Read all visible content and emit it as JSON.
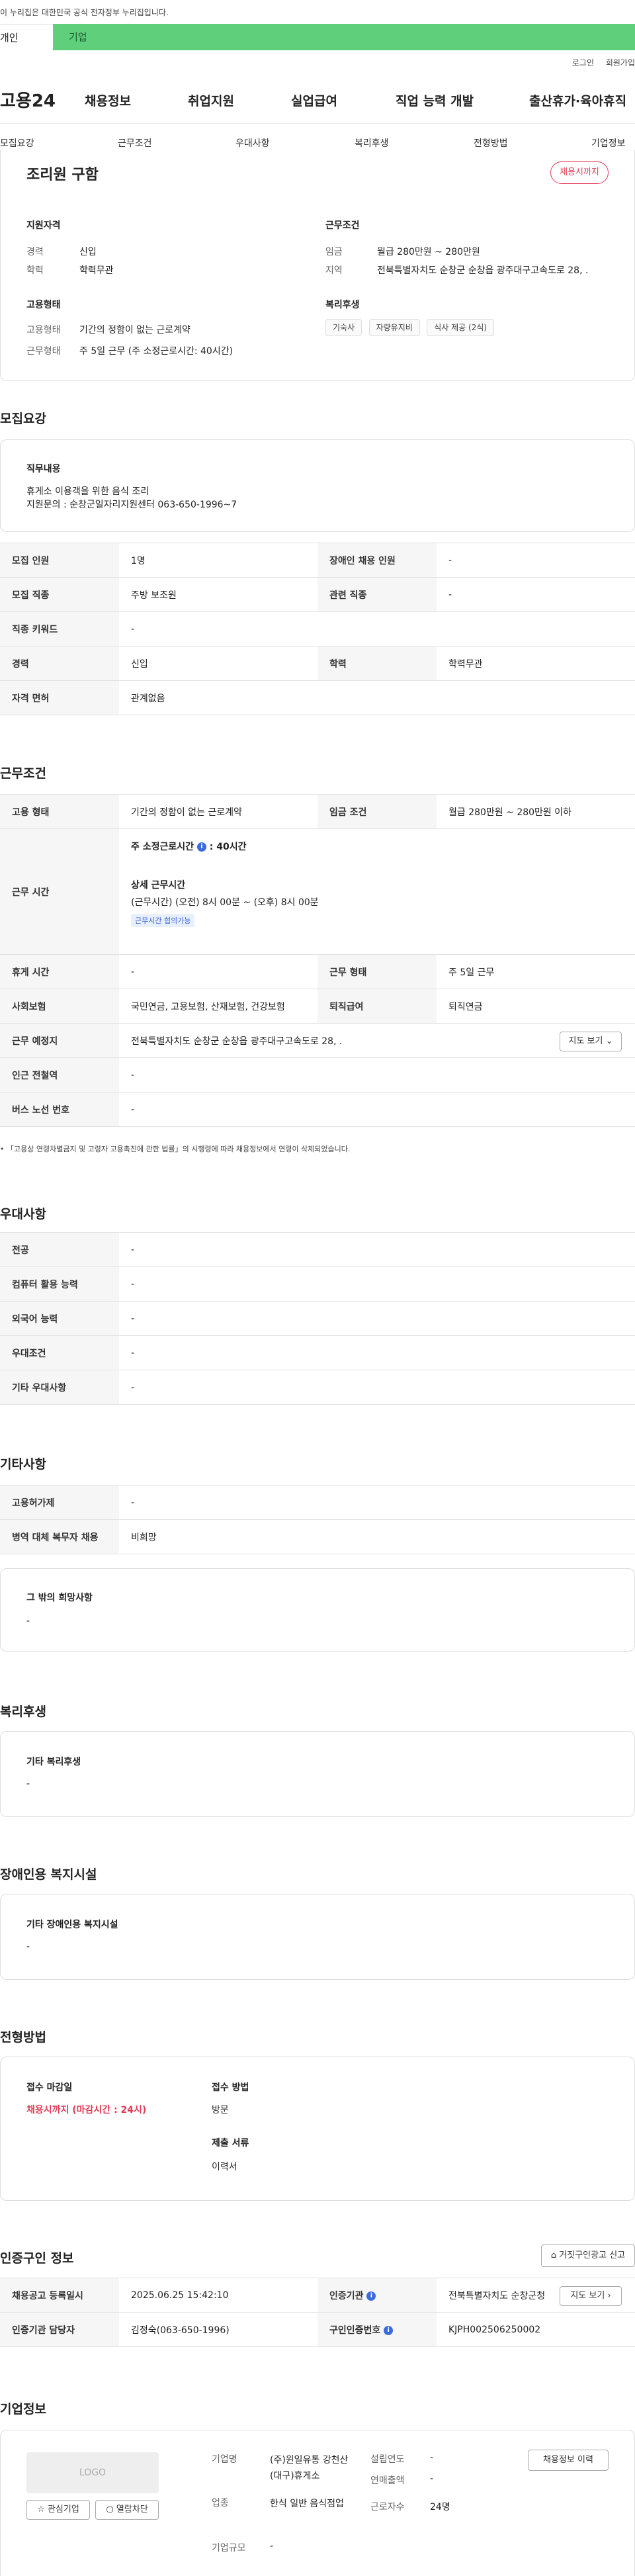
{
  "top": {
    "notice": "이 누리집은 대한민국 공식 전자정부 누리집입니다.",
    "user_tabs": [
      "개인",
      "기업"
    ],
    "util": [
      "로그인",
      "회원가입"
    ]
  },
  "gnb": {
    "logo": "고용24",
    "menus": [
      "채용정보",
      "취업지원",
      "실업급여",
      "직업 능력 개발",
      "출산휴가·육아휴직"
    ]
  },
  "anchors": [
    "모집요강",
    "근무조건",
    "우대사항",
    "복리후생",
    "전형방법",
    "기업정보"
  ],
  "summary": {
    "title": "조리원 구함",
    "badge": "채용시까지",
    "qual_label": "지원자격",
    "career_k": "경력",
    "career_v": "신입",
    "edu_k": "학력",
    "edu_v": "학력무관",
    "cond_label": "근무조건",
    "wage_k": "임금",
    "wage_v": "월급 280만원 ~ 280만원",
    "region_k": "지역",
    "region_v": "전북특별자치도 순창군 순창읍 광주대구고속도로 28, .",
    "emp_label": "고용형태",
    "emptype_k": "고용형태",
    "emptype_v": "기간의 정함이 없는 근로계약",
    "worktype_k": "근무형태",
    "worktype_v": "주 5일 근무 (주 소정근로시간: 40시간)",
    "welfare_label": "복리후생",
    "welfare_chips": [
      "기숙사",
      "자량유지비",
      "식사 제공 (2식)"
    ]
  },
  "recruit": {
    "title": "모집요강",
    "duty_label": "직무내용",
    "duty_line1": "휴게소 이용객을 위한 음식 조리",
    "duty_line2": "지원문의 : 순창군일자리지원센터 063-650-1996~7",
    "rows": [
      {
        "k1": "모집 인원",
        "v1": "1명",
        "k2": "장애인 채용 인원",
        "v2": "-"
      },
      {
        "k1": "모집 직종",
        "v1": "주방 보조원",
        "k2": "관련 직종",
        "v2": "-"
      },
      {
        "k1": "직종 키워드",
        "v1": "-"
      },
      {
        "k1": "경력",
        "v1": "신입",
        "k2": "학력",
        "v2": "학력무관"
      },
      {
        "k1": "자격 면허",
        "v1": "관계없음"
      }
    ]
  },
  "work": {
    "title": "근무조건",
    "emptype_k": "고용 형태",
    "emptype_v": "기간의 정함이 없는 근로계약",
    "wage_k": "임금 조건",
    "wage_v": "월급 280만원 ~ 280만원 이하",
    "hours_k": "근무 시간",
    "hours_main": "주 소정근로시간",
    "hours_main_v": ": 40시간",
    "hours_detail_label": "상세 근무시간",
    "hours_detail_v": "(근무시간) (오전) 8시 00분 ~ (오후) 8시 00분",
    "hours_tag": "근무시간 협의가능",
    "rest_k": "휴게 시간",
    "rest_v": "-",
    "worktype_k": "근무 형태",
    "worktype_v": "주 5일 근무",
    "insurance_k": "사회보험",
    "insurance_v": "국민연금, 고용보험, 산재보험, 건강보험",
    "retire_k": "퇴직급여",
    "retire_v": "퇴직연금",
    "place_k": "근무 예정지",
    "place_v": "전북특별자치도 순창군 순창읍 광주대구고속도로 28, .",
    "map_btn": "지도 보기",
    "subway_k": "인근 전철역",
    "subway_v": "-",
    "bus_k": "버스 노선 번호",
    "bus_v": "-",
    "footnote": "「고용상 연령차별금지 및 고령자 고용촉진에 관한 법률」의 시행령에 따라 채용정보에서 연령이 삭제되었습니다."
  },
  "prefer": {
    "title": "우대사항",
    "rows": [
      {
        "k": "전공",
        "v": "-"
      },
      {
        "k": "컴퓨터 활용 능력",
        "v": "-"
      },
      {
        "k": "외국어 능력",
        "v": "-"
      },
      {
        "k": "우대조건",
        "v": "-"
      },
      {
        "k": "기타 우대사항",
        "v": "-"
      }
    ]
  },
  "etc": {
    "title": "기타사항",
    "rows": [
      {
        "k": "고용허가제",
        "v": "-"
      },
      {
        "k": "병역 대체 복무자 채용",
        "v": "비희망"
      }
    ],
    "other_label": "그 밖의 희망사항",
    "other_v": "-"
  },
  "welfare": {
    "title": "복리후생",
    "label": "기타 복리후생",
    "v": "-"
  },
  "disabled": {
    "title": "장애인용 복지시설",
    "label": "기타 장애인용 복지시설",
    "v": "-"
  },
  "process": {
    "title": "전형방법",
    "deadline_label": "접수 마감일",
    "deadline_v": "채용시까지 (마감시간 : 24시)",
    "method_label": "접수 방법",
    "method_v": "방문",
    "docs_label": "제출 서류",
    "docs_v": "이력서"
  },
  "cert": {
    "title": "인증구인 정보",
    "report_btn": "거짓구인광고 신고",
    "reg_k": "채용공고 등록일시",
    "reg_v": "2025.06.25 15:42:10",
    "agency_k": "인증기관",
    "agency_v": "전북특별자치도 순창군청",
    "map_btn": "지도 보기",
    "manager_k": "인증기관 담당자",
    "manager_v": "김정숙(063-650-1996)",
    "no_k": "구인인증번호",
    "no_v": "KJPH002506250002"
  },
  "company": {
    "title": "기업정보",
    "logo": "LOGO",
    "fav_btn": "관심기업",
    "block_btn": "열람차단",
    "name_k": "기업명",
    "name_v": "(주)윈일유통 강천산(대구)휴게소",
    "year_k": "설립연도",
    "year_v": "-",
    "sales_k": "연매출액",
    "sales_v": "-",
    "industry_k": "업종",
    "industry_v": "한식 일반 음식점업",
    "staff_k": "근로자수",
    "staff_v": "24명",
    "size_k": "기업규모",
    "size_v": "-",
    "history_btn": "채용정보 이력"
  },
  "colors": {
    "brand_green": "#5fcf7c",
    "accent_red": "#e23a55",
    "info_blue": "#3b6be0"
  }
}
